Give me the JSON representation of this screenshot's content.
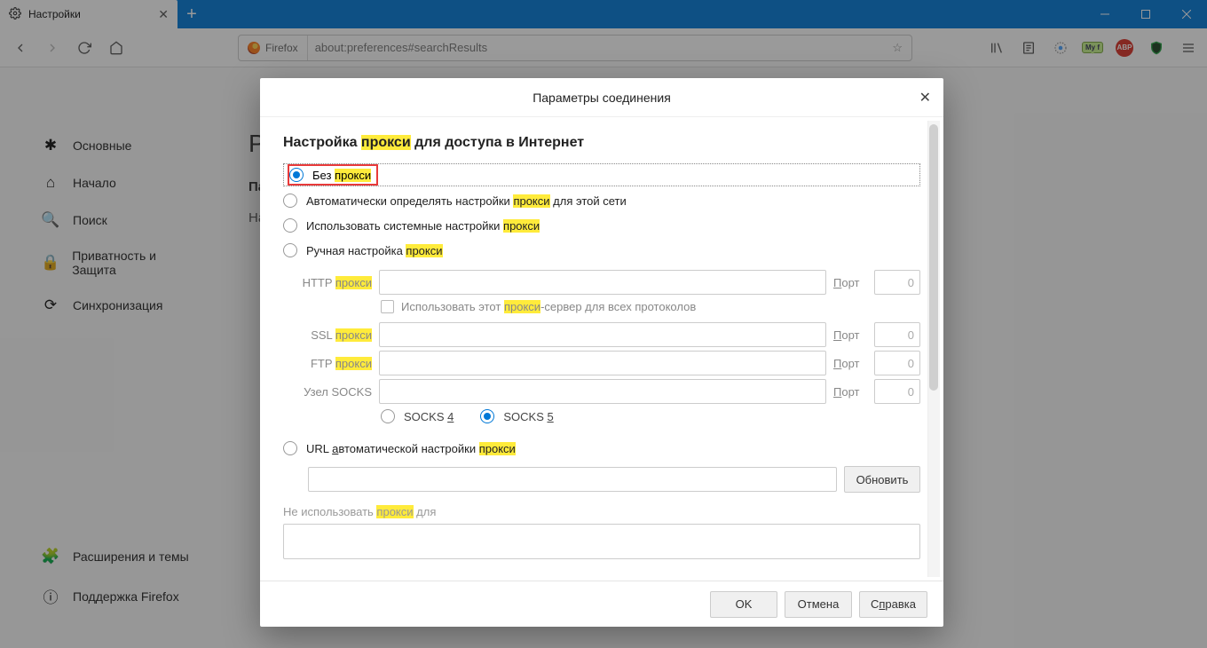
{
  "titlebar": {
    "tab_title": "Настройки"
  },
  "urlbar": {
    "identity": "Firefox",
    "url": "about:preferences#searchResults"
  },
  "sidebar": {
    "items": [
      {
        "label": "Основные"
      },
      {
        "label": "Начало"
      },
      {
        "label": "Поиск"
      },
      {
        "label": "Приватность и Защита"
      },
      {
        "label": "Синхронизация"
      }
    ],
    "bottom": [
      {
        "label": "Расширения и темы"
      },
      {
        "label": "Поддержка Firefox"
      }
    ]
  },
  "main": {
    "heading_prefix": "Ре",
    "para_label": "Параметры сети",
    "desc": "Настройка"
  },
  "dialog": {
    "title": "Параметры соединения",
    "section_pre": "Настройка ",
    "section_hl": "прокси",
    "section_post": " для доступа в Интернет",
    "radios": {
      "no_proxy_pre": "Без ",
      "no_proxy_hl": "прокси",
      "auto_pre": "Автоматически определять настройки ",
      "auto_hl": "прокси",
      "auto_post": " для этой сети",
      "system_pre": "Использовать системные настройки ",
      "system_hl": "прокси",
      "manual_pre": "Ручная настройка ",
      "manual_hl": "прокси",
      "url_pre": "URL ",
      "url_ak": "а",
      "url_mid": "втоматической настройки ",
      "url_hl": "прокси"
    },
    "fields": {
      "http_pre": "HTTP ",
      "http_hl": "прокси",
      "ssl_pre": "SSL ",
      "ssl_hl": "прокси",
      "ftp_pre": "FTP ",
      "ftp_hl": "прокси",
      "socks": "Узел SOCKS",
      "port_pre": "П",
      "port_post": "орт",
      "port_val": "0",
      "allproto_pre": "Использовать этот ",
      "allproto_hl": "прокси",
      "allproto_post": "-сервер для всех протоколов",
      "socks4_pre": "SOCKS ",
      "socks4_ak": "4",
      "socks5_pre": "SOCKS ",
      "socks5_ak": "5",
      "reload": "Обновить",
      "noproxy_pre": "Не использовать ",
      "noproxy_hl": "прокси",
      "noproxy_post": " для"
    },
    "buttons": {
      "ok": "OK",
      "cancel": "Отмена",
      "help_pre": "С",
      "help_post": "равка",
      "help_ak": "п"
    }
  }
}
